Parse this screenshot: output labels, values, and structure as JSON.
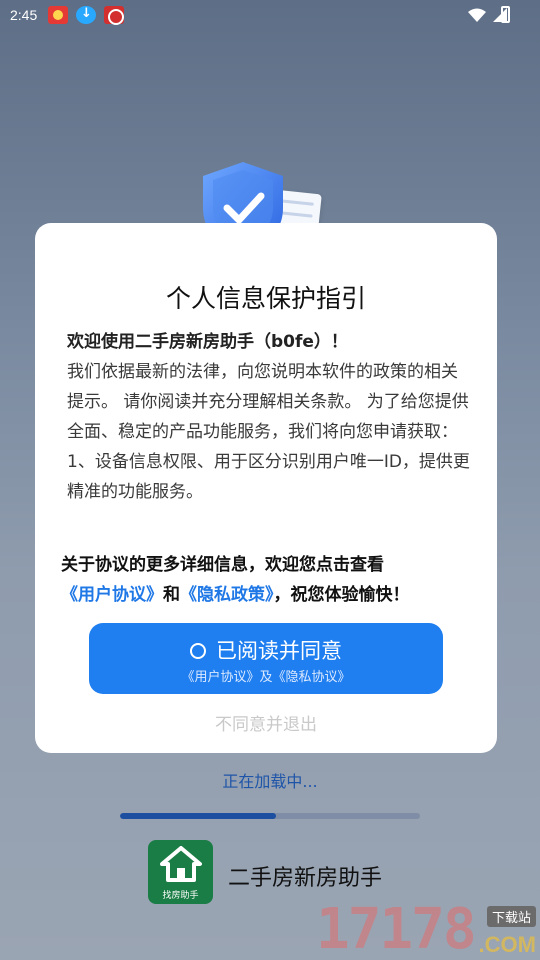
{
  "status_bar": {
    "time": "2:45"
  },
  "dialog": {
    "title": "个人信息保护指引",
    "greeting": "欢迎使用二手房新房助手（b0fe）！",
    "body": "我们依据最新的法律，向您说明本软件的政策的相关提示。 请你阅读并充分理解相关条款。 为了给您提供全面、稳定的产品功能服务，我们将向您申请获取：",
    "item1": "1、设备信息权限、用于区分识别用户唯一ID，提供更精准的功能服务。",
    "agreement_intro": "关于协议的更多详细信息，欢迎您点击查看",
    "user_agreement_link": "《用户协议》",
    "and_text": "和",
    "privacy_policy_link": "《隐私政策》",
    "agreement_outro": "，祝您体验愉快！",
    "agree_button_label": "已阅读并同意",
    "agree_button_sub": "《用户协议》及《隐私协议》",
    "decline_label": "不同意并退出"
  },
  "loading": {
    "text": "正在加载中...",
    "progress": 0.52
  },
  "app": {
    "logo_text": "找房助手",
    "name": "二手房新房助手"
  },
  "watermark": {
    "number": "17178",
    "tag": "下载站",
    "domain": ".COM"
  },
  "colors": {
    "accent": "#1f7ff0",
    "link": "#1f78e6",
    "brand_green": "#1a7d45"
  }
}
